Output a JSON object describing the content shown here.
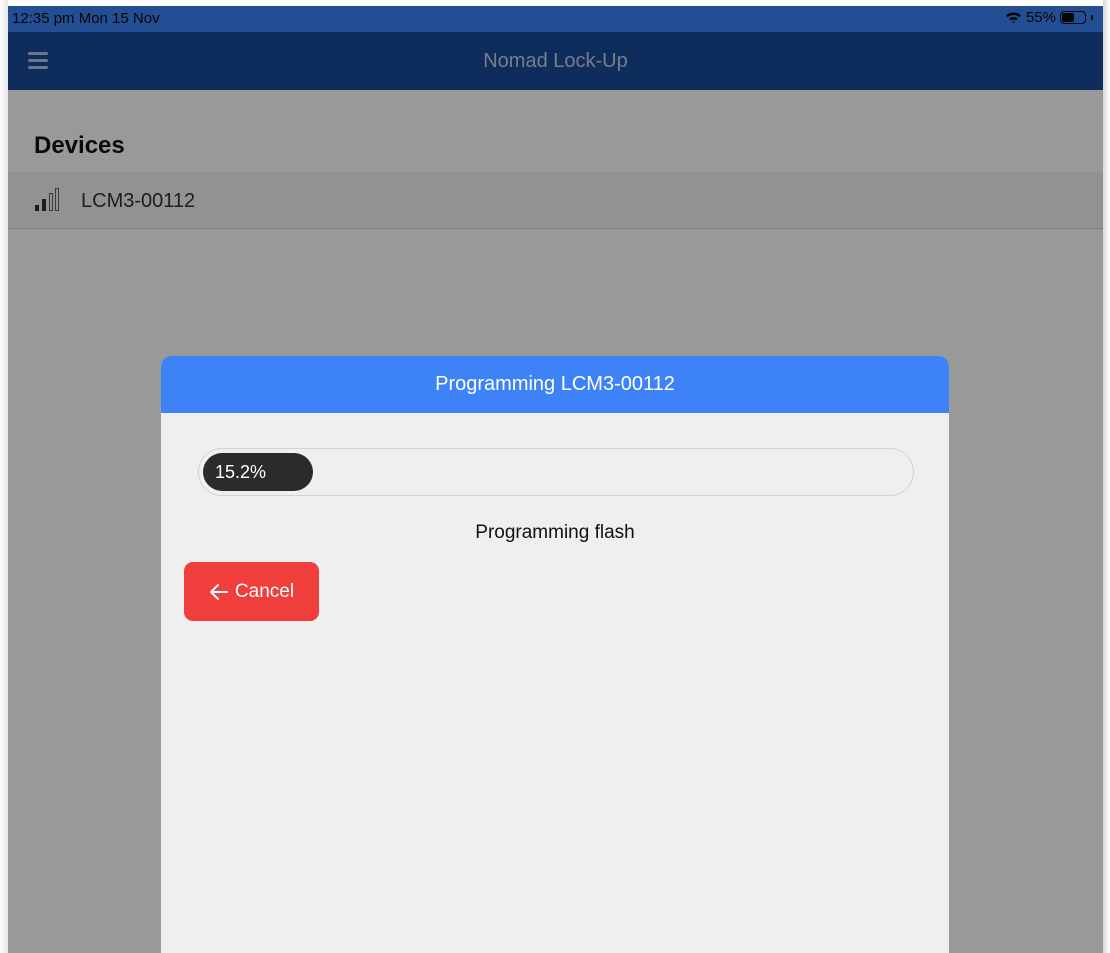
{
  "status_bar": {
    "time": "12:35 pm  Mon 15 Nov",
    "battery_label": "55%",
    "battery_level_percent": 55,
    "wifi_icon": "wifi-icon",
    "battery_icon": "battery-icon"
  },
  "header": {
    "title": "Nomad Lock-Up",
    "menu_icon": "hamburger-menu-icon"
  },
  "devices": {
    "title": "Devices",
    "items": [
      {
        "name": "LCM3-00112",
        "signal_icon": "signal-strength-icon",
        "signal_bars": 2
      }
    ]
  },
  "dialog": {
    "title": "Programming LCM3-00112",
    "progress": {
      "label": "15.2%",
      "value_percent": 15.2
    },
    "status": "Programming flash",
    "cancel_label": "Cancel",
    "cancel_icon": "arrow-left-icon"
  },
  "colors": {
    "status_bar": "#3d82f7",
    "header": "#1a4c99",
    "dialog_header": "#3d82f7",
    "cancel": "#ef3e3c",
    "progress_fill": "#2b2b2b"
  }
}
